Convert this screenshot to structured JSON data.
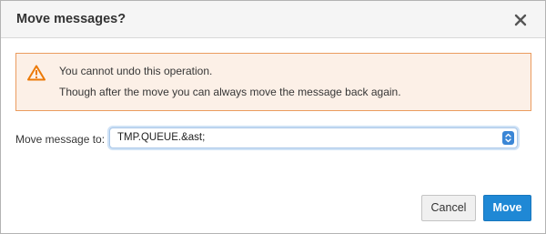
{
  "dialog": {
    "title": "Move messages?",
    "close_icon": "close-icon"
  },
  "alert": {
    "icon": "warning-icon",
    "line1": "You cannot undo this operation.",
    "line2": "Though after the move you can always move the message back again."
  },
  "form": {
    "label": "Move message to:",
    "selected_value": "TMP.QUEUE.&ast;",
    "arrow_icon": "select-arrows-icon"
  },
  "buttons": {
    "cancel": "Cancel",
    "move": "Move"
  },
  "colors": {
    "primary": "#1f88d5",
    "alert_background": "#fcf0e7",
    "alert_border": "#eb9c5f",
    "warning_icon": "#ec7a08"
  }
}
